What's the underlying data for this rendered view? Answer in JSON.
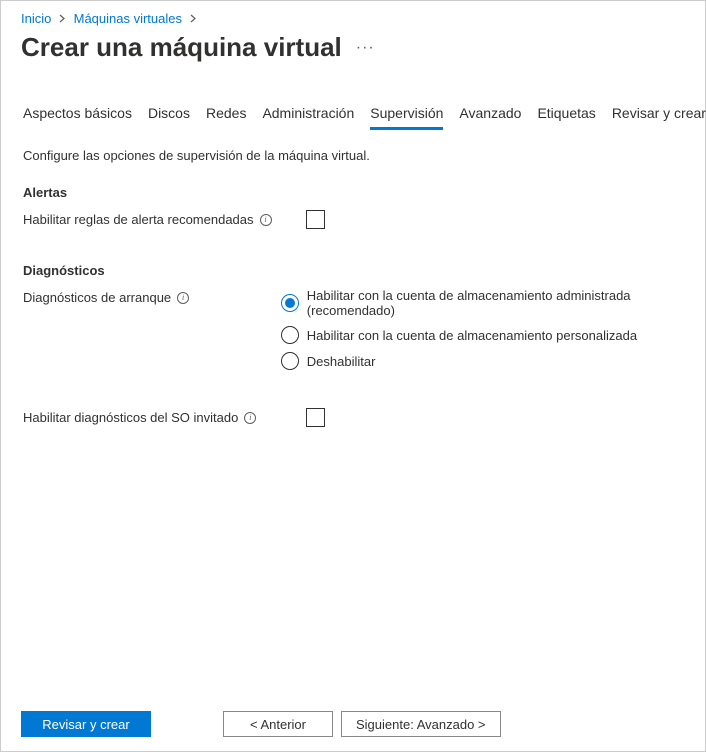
{
  "breadcrumb": {
    "home": "Inicio",
    "vms": "Máquinas virtuales"
  },
  "page": {
    "title": "Crear una máquina virtual",
    "ellipsis": "···"
  },
  "tabs": {
    "basics": "Aspectos básicos",
    "disks": "Discos",
    "networking": "Redes",
    "management": "Administración",
    "monitoring": "Supervisión",
    "advanced": "Avanzado",
    "tags": "Etiquetas",
    "review": "Revisar y crear"
  },
  "intro": "Configure las opciones de supervisión de la máquina virtual.",
  "alerts": {
    "heading": "Alertas",
    "enable_recommended_label": "Habilitar reglas de alerta recomendadas"
  },
  "diagnostics": {
    "heading": "Diagnósticos",
    "boot_label": "Diagnósticos de arranque",
    "boot_options": {
      "managed": "Habilitar con la cuenta de almacenamiento administrada (recomendado)",
      "custom": "Habilitar con la cuenta de almacenamiento personalizada",
      "disable": "Deshabilitar"
    },
    "guest_os_label": "Habilitar diagnósticos del SO invitado"
  },
  "footer": {
    "review": "Revisar y crear",
    "previous": "<  Anterior",
    "next": "Siguiente: Avanzado  >"
  }
}
